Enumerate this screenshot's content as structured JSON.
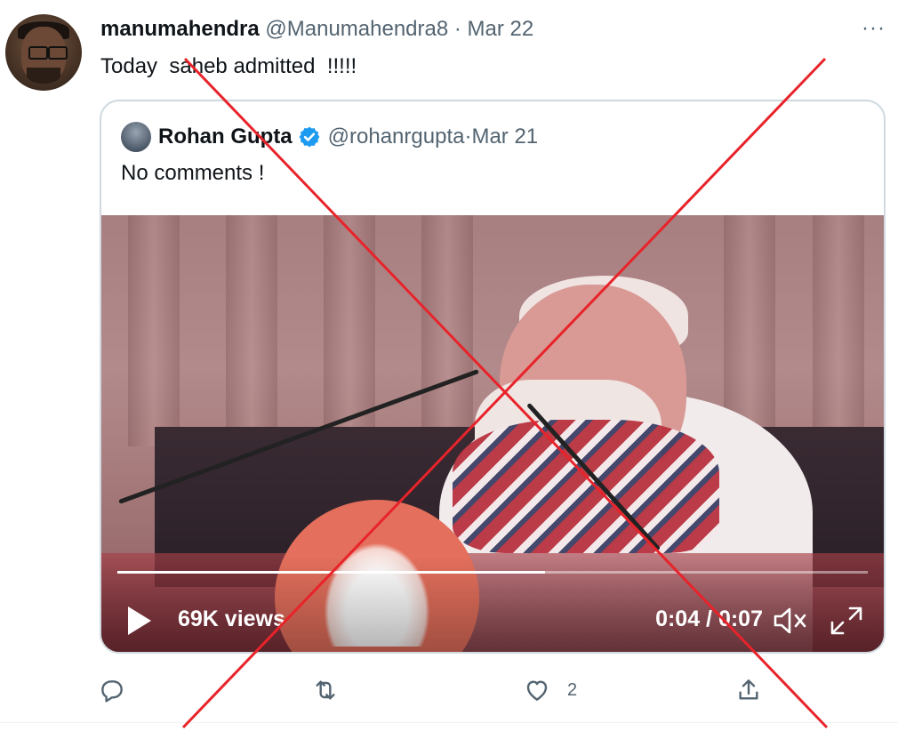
{
  "tweet": {
    "display_name": "manumahendra",
    "handle": "@Manumahendra8",
    "separator": " · ",
    "date": "Mar 22",
    "text": "Today  saheb admitted  !!!!!",
    "more_label": "···"
  },
  "quoted_tweet": {
    "display_name": "Rohan Gupta",
    "handle": "@rohanrgupta",
    "separator": " · ",
    "date": "Mar 21",
    "text": "No comments !",
    "verified": true,
    "verified_color": "#1d9bf0"
  },
  "video": {
    "views": "69K views",
    "time": "0:04 / 0:07",
    "progress_fraction": 0.57
  },
  "actions": {
    "reply_count": "",
    "retweet_count": "",
    "like_count": "2",
    "share_count": ""
  },
  "icons": [
    "reply-icon",
    "retweet-icon",
    "like-icon",
    "share-icon",
    "play-icon",
    "mute-icon",
    "fullscreen-icon",
    "verified-badge-icon",
    "more-icon"
  ],
  "colors": {
    "overlay_cross": "#e8232a",
    "secondary_text": "#536471",
    "card_border": "#cfd9de"
  }
}
